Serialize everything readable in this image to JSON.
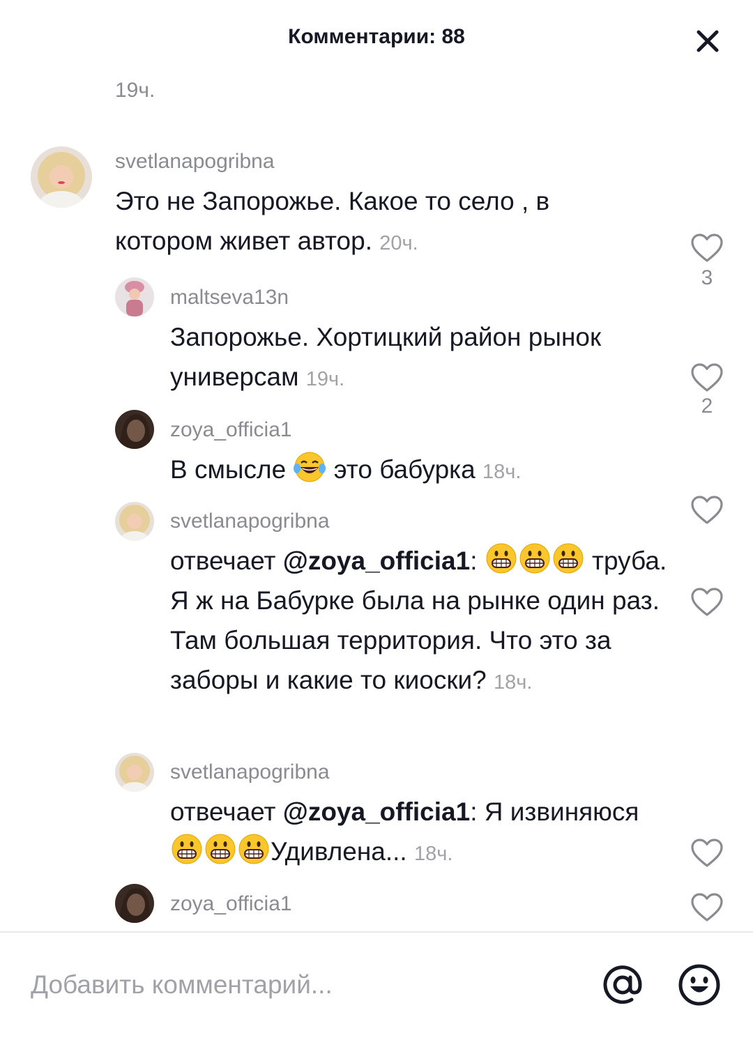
{
  "header": {
    "title": "Комментарии: 88"
  },
  "previous_time": "19ч.",
  "comments": [
    {
      "username": "svetlanapogribna",
      "text": "Это не Запорожье. Какое то село , в котором живет автор.",
      "time": "20ч.",
      "likes": "3"
    },
    {
      "username": "maltseva13n",
      "text": "Запорожье. Хортицкий район рынок универсам",
      "time": "19ч.",
      "likes": "2"
    },
    {
      "username": "zoya_officia1",
      "text_before": "В смысле",
      "text_after": "это бабурка",
      "time": "18ч."
    },
    {
      "username": "svetlanapogribna",
      "reply_prefix": "отвечает",
      "mention": "@zoya_officia1",
      "text": "труба. Я ж на Бабурке была на рынке один раз. Там большая территория. Что это за заборы и какие то киоски?",
      "time": "18ч."
    },
    {
      "username": "svetlanapogribna",
      "reply_prefix": "отвечает",
      "mention": "@zoya_officia1",
      "text_start": "Я извиняюся",
      "text_end": "Удивлена...",
      "time": "18ч."
    },
    {
      "username": "zoya_officia1"
    }
  ],
  "input": {
    "placeholder": "Добавить комментарий..."
  },
  "icons": {
    "close": "close-icon",
    "like": "heart-outline-icon",
    "mention": "at-sign-icon",
    "emoji": "emoji-smile-icon"
  },
  "colors": {
    "text": "#161823",
    "muted": "#8a8b91",
    "divider": "#e8e8ea"
  }
}
